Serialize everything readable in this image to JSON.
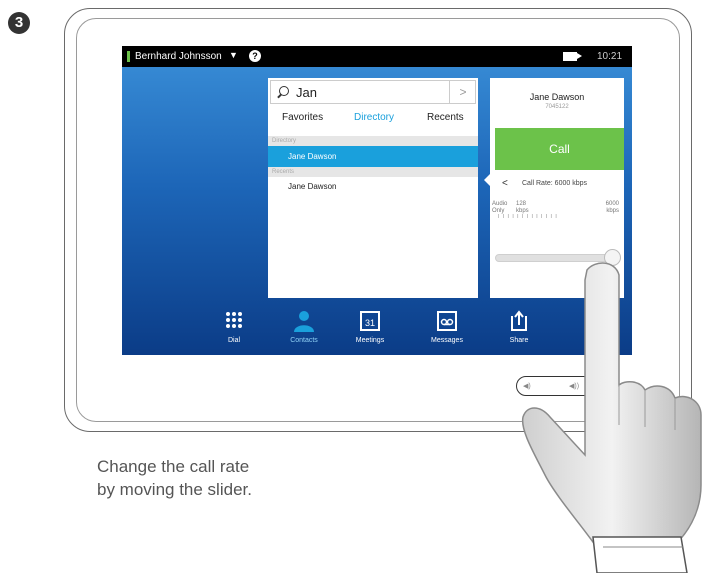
{
  "step_number": "3",
  "topbar": {
    "user": "Bernhard Johnsson",
    "help": "?",
    "time": "10:21"
  },
  "directory": {
    "search_value": "Jan",
    "search_arrow": ">",
    "tabs": [
      "Favorites",
      "Directory",
      "Recents"
    ],
    "active_tab": "Directory",
    "section_directory": "Directory",
    "selected_contact": "Jane Dawson",
    "section_recents": "Recents",
    "recent_contact": "Jane Dawson"
  },
  "call_panel": {
    "contact_name": "Jane Dawson",
    "contact_number": "7045122",
    "call_label": "Call",
    "back_glyph": "<",
    "rate_label": "Call Rate: 6000 kbps",
    "scale_audio_1": "Audio",
    "scale_audio_2": "Only",
    "scale_min_1": "128",
    "scale_min_2": "kbps",
    "scale_max_1": "6000",
    "scale_max_2": "kbps",
    "tick_marks": "I     I I I I I I I I I I I I",
    "slider_fraction": 1.0
  },
  "dock": {
    "items": [
      {
        "label": "Dial",
        "icon": "dial-pad-icon"
      },
      {
        "label": "Contacts",
        "icon": "contacts-icon"
      },
      {
        "label": "Meetings",
        "icon": "calendar-icon",
        "badge": "31"
      },
      {
        "label": "Messages",
        "icon": "voicemail-icon"
      },
      {
        "label": "Share",
        "icon": "share-icon"
      }
    ]
  },
  "volume": {
    "down": "◀)",
    "up": "◀))"
  },
  "caption": {
    "line1": "Change the call rate",
    "line2": "by moving the slider."
  },
  "colors": {
    "accent_blue": "#1aa0dc",
    "call_green": "#6cc24a",
    "presence_green": "#6cc24a"
  }
}
